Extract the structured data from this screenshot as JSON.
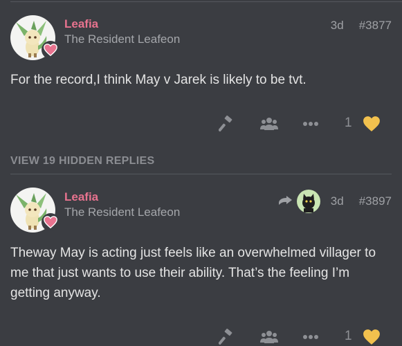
{
  "colors": {
    "background": "#3b3d42",
    "username": "#e8738f",
    "like_heart": "#f2c14e",
    "muted": "#8e9095"
  },
  "posts": [
    {
      "username": "Leafia",
      "user_title": "The Resident Leafeon",
      "age": "3d",
      "post_number": "#3877",
      "body": "For the record,I think May v Jarek is likely to be tvt.",
      "like_count": "1",
      "icons": [
        "gavel-icon",
        "users-icon",
        "ellipsis-icon",
        "heart-icon"
      ]
    },
    {
      "username": "Leafia",
      "user_title": "The Resident Leafeon",
      "age": "3d",
      "post_number": "#3897",
      "body": "Theway May is acting just feels like an overwhelmed villager to me that just wants to use their ability. That’s the feeling I’m getting anyway.",
      "like_count": "1",
      "icons": [
        "reply-arrow-icon",
        "black-cat-avatar",
        "gavel-icon",
        "users-icon",
        "ellipsis-icon",
        "heart-icon"
      ]
    }
  ],
  "hidden_replies_label": "VIEW 19 HIDDEN REPLIES"
}
